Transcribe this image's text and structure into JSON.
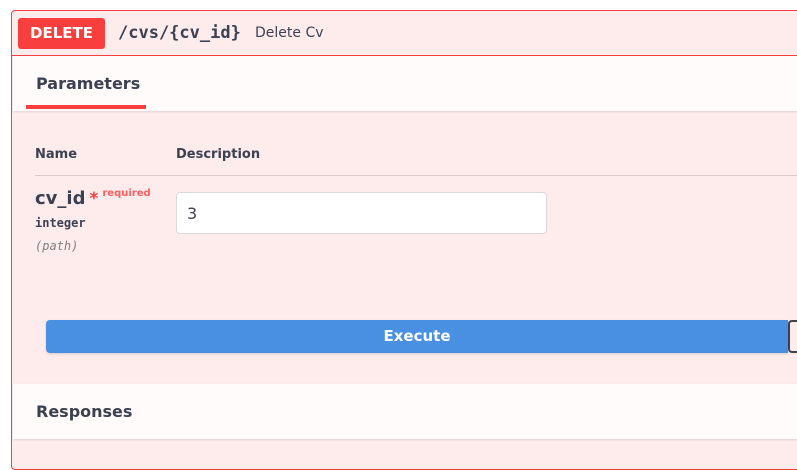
{
  "operation": {
    "method": "DELETE",
    "path": "/cvs/{cv_id}",
    "description": "Delete Cv"
  },
  "parameters_section": {
    "tab_label": "Parameters",
    "col_name": "Name",
    "col_description": "Description",
    "params": [
      {
        "name": "cv_id",
        "required_marker": "*",
        "required_label": "required",
        "type": "integer",
        "in": "(path)",
        "value": "3"
      }
    ]
  },
  "execute_label": "Execute",
  "responses_section": {
    "title": "Responses"
  },
  "colors": {
    "delete": "#f93e3e",
    "execute": "#4990e2",
    "text": "#3b4151"
  }
}
